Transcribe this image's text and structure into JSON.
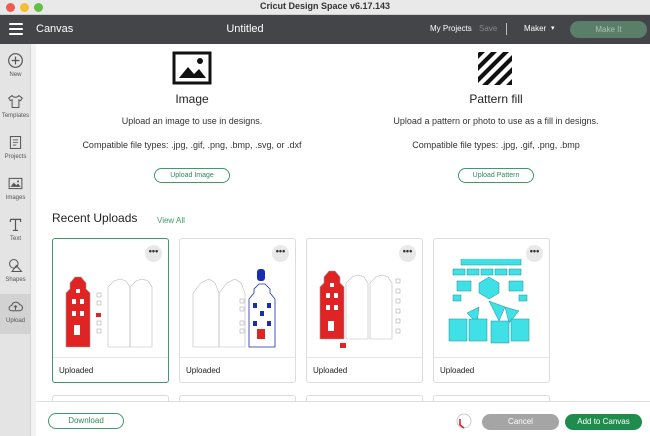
{
  "window": {
    "title": "Cricut Design Space  v6.17.143"
  },
  "header": {
    "app_name": "Canvas",
    "doc_title": "Untitled",
    "my_projects": "My Projects",
    "save": "Save",
    "machine": "Maker",
    "make_it": "Make It"
  },
  "sidebar": {
    "items": [
      {
        "label": "New",
        "icon": "plus-circle-icon"
      },
      {
        "label": "Templates",
        "icon": "shirt-icon"
      },
      {
        "label": "Projects",
        "icon": "projects-icon"
      },
      {
        "label": "Images",
        "icon": "image-icon"
      },
      {
        "label": "Text",
        "icon": "text-icon"
      },
      {
        "label": "Shapes",
        "icon": "shapes-icon"
      },
      {
        "label": "Upload",
        "icon": "upload-cloud-icon"
      }
    ]
  },
  "upload_image": {
    "title": "Image",
    "description": "Upload an image to use in designs.",
    "types": "Compatible file types: .jpg, .gif, .png, .bmp, .svg, or .dxf",
    "button": "Upload Image"
  },
  "pattern_fill": {
    "title": "Pattern fill",
    "description": "Upload a pattern or photo to use as a fill in designs.",
    "types": "Compatible file types: .jpg, .gif, .png, .bmp",
    "button": "Upload Pattern"
  },
  "recent": {
    "title": "Recent Uploads",
    "view_all": "View All",
    "more": "•••",
    "cards": [
      {
        "caption": "Uploaded"
      },
      {
        "caption": "Uploaded"
      },
      {
        "caption": "Uploaded"
      },
      {
        "caption": "Uploaded"
      }
    ]
  },
  "footer": {
    "download": "Download",
    "cancel": "Cancel",
    "add": "Add to Canvas"
  },
  "colors": {
    "accent": "#3e9a6a",
    "primary_button": "#1f8c4e",
    "header_bg": "#434548",
    "house_red": "#e02424",
    "house_blue": "#1a2fb0",
    "pattern_cyan": "#3fe0e6"
  }
}
